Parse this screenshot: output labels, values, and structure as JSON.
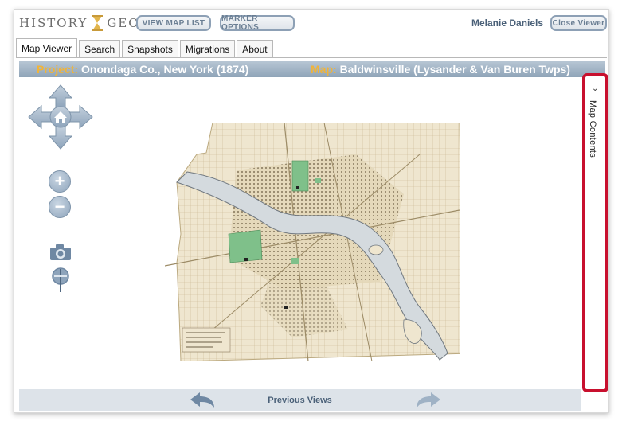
{
  "header": {
    "logo_left": "HISTORY",
    "logo_right": "GEO",
    "view_map_list": "VIEW MAP LIST",
    "marker_options": "MARKER OPTIONS",
    "user_name": "Melanie Daniels",
    "close_viewer": "Close Viewer"
  },
  "tabs": [
    {
      "label": "Map Viewer",
      "active": true
    },
    {
      "label": "Search"
    },
    {
      "label": "Snapshots"
    },
    {
      "label": "Migrations"
    },
    {
      "label": "About"
    }
  ],
  "project_bar": {
    "project_label": "Project:",
    "project_value": "Onondaga Co., New York (1874)",
    "map_label": "Map:",
    "map_value": "Baldwinsville (Lysander & Van Buren Twps)"
  },
  "map_controls": {
    "zoom_in": "+",
    "zoom_out": "−",
    "icons": [
      "home-icon",
      "pan-arrows-icon",
      "camera-icon",
      "pin-icon"
    ]
  },
  "map_contents": {
    "label": "Map Contents",
    "chevron": "⌄"
  },
  "footer": {
    "previous_views": "Previous Views"
  },
  "colors": {
    "accent_blue": "#8fa4b8",
    "label_gold": "#f0b43a",
    "highlight_red": "#c8102e",
    "text_blue": "#4a6078"
  }
}
